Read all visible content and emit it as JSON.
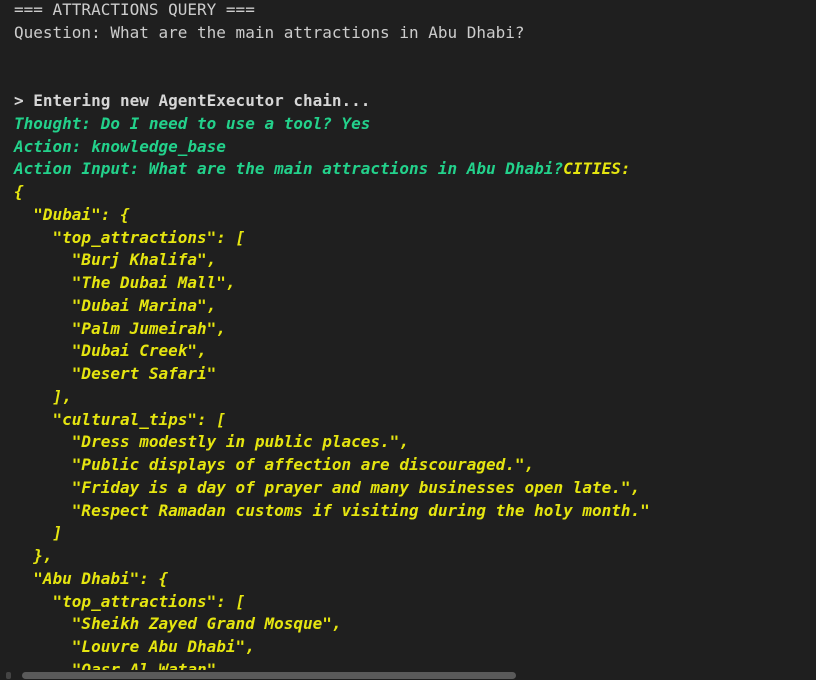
{
  "terminal": {
    "header": "=== ATTRACTIONS QUERY ===",
    "question": "Question: What are the main attractions in Abu Dhabi?",
    "chain_start": "> Entering new AgentExecutor chain...",
    "thought": "Thought: Do I need to use a tool? Yes",
    "action": "Action: knowledge_base",
    "action_input": "Action Input: What are the main attractions in Abu Dhabi?",
    "cities_label": "CITIES:",
    "json_lines": [
      "{",
      "  \"Dubai\": {",
      "    \"top_attractions\": [",
      "      \"Burj Khalifa\",",
      "      \"The Dubai Mall\",",
      "      \"Dubai Marina\",",
      "      \"Palm Jumeirah\",",
      "      \"Dubai Creek\",",
      "      \"Desert Safari\"",
      "    ],",
      "    \"cultural_tips\": [",
      "      \"Dress modestly in public places.\",",
      "      \"Public displays of affection are discouraged.\",",
      "      \"Friday is a day of prayer and many businesses open late.\",",
      "      \"Respect Ramadan customs if visiting during the holy month.\"",
      "    ]",
      "  },",
      "  \"Abu Dhabi\": {",
      "    \"top_attractions\": [",
      "      \"Sheikh Zayed Grand Mosque\",",
      "      \"Louvre Abu Dhabi\",",
      "      \"Qasr Al Watan\","
    ]
  },
  "colors": {
    "background": "#1f1f1f",
    "plain_text": "#cccccc",
    "green": "#23d18b",
    "yellow": "#e5e510"
  }
}
